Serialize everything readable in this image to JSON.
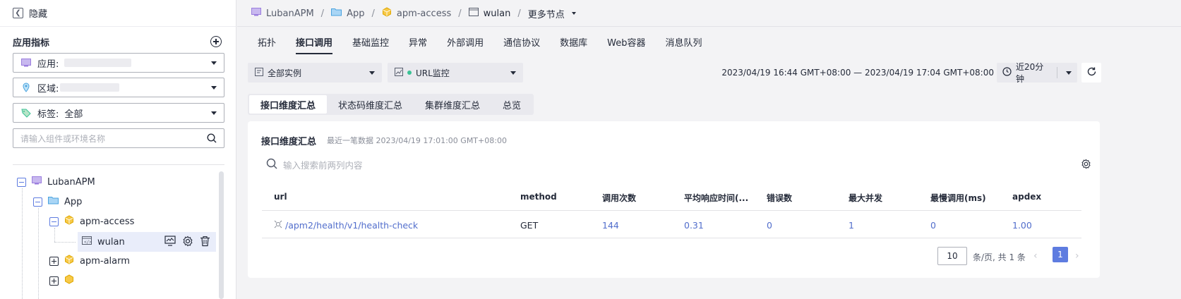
{
  "sidebar": {
    "hide_label": "隐藏",
    "section_title": "应用指标",
    "filters": {
      "app_label": "应用:",
      "region_label": "区域:",
      "tag_label": "标签:",
      "tag_value": "全部"
    },
    "search_placeholder": "请输入组件或环境名称",
    "tree": {
      "root": "LubanAPM",
      "app": "App",
      "component1": "apm-access",
      "env": "wulan",
      "component2": "apm-alarm"
    }
  },
  "breadcrumb": {
    "items": [
      "LubanAPM",
      "App",
      "apm-access",
      "wulan"
    ],
    "more": "更多节点"
  },
  "tabs": [
    "拓扑",
    "接口调用",
    "基础监控",
    "异常",
    "外部调用",
    "通信协议",
    "数据库",
    "Web容器",
    "消息队列"
  ],
  "toolbar": {
    "instance_select": "全部实例",
    "monitor_select": "URL监控",
    "time_range": "2023/04/19 16:44 GMT+08:00 — 2023/04/19 17:04 GMT+08:00",
    "time_preset": "近20分钟"
  },
  "subtabs": [
    "接口维度汇总",
    "状态码维度汇总",
    "集群维度汇总",
    "总览"
  ],
  "card": {
    "title": "接口维度汇总",
    "subtitle": "最近一笔数据 2023/04/19 17:01:00 GMT+08:00",
    "search_placeholder": "输入搜索前两列内容"
  },
  "table": {
    "columns": [
      "url",
      "method",
      "调用次数",
      "平均响应时间(...",
      "错误数",
      "最大并发",
      "最慢调用(ms)",
      "apdex"
    ],
    "rows": [
      [
        "/apm2/health/v1/health-check",
        "GET",
        "144",
        "0.31",
        "0",
        "1",
        "0",
        "1.00"
      ]
    ]
  },
  "pagination": {
    "page_size": "10",
    "summary": "条/页, 共 1 条",
    "current": "1"
  },
  "colors": {
    "accent": "#5e7ce0",
    "link": "#526ecc",
    "status_dot": "#3ac295"
  }
}
